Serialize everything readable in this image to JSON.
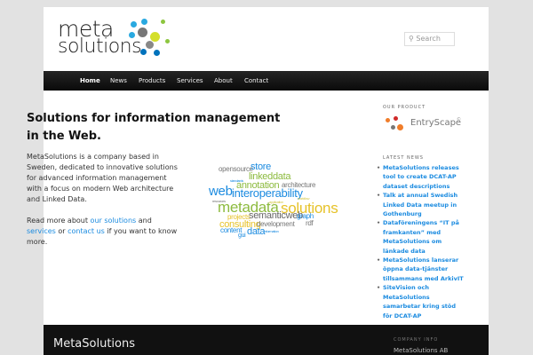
{
  "logo": {
    "line1": "meta",
    "line2": "solutions"
  },
  "search": {
    "placeholder": "Search"
  },
  "nav": {
    "items": [
      "Home",
      "News",
      "Products",
      "Services",
      "About",
      "Contact"
    ]
  },
  "main": {
    "title": "Solutions for information management in the Web.",
    "intro": "MetaSolutions is a company based in Sweden, dedicated to innovative solutions for advanced information management with a focus on modern Web architecture and Linked Data.",
    "read_prefix": "Read more about ",
    "link_solutions": "our solutions",
    "and": " and ",
    "link_services": "services",
    "or": " or ",
    "link_contact": "contact us",
    "read_suffix": " if you want to know more."
  },
  "word_cloud": [
    "opensource",
    "store",
    "linkeddata",
    "standards",
    "annotation",
    "architecture",
    "web",
    "interoperability",
    "resources",
    "application",
    "metadata",
    "solutions",
    "projects",
    "semanticweb",
    "graph",
    "consulting",
    "development",
    "rdf",
    "content",
    "data",
    "information",
    "gui",
    "workflow"
  ],
  "sidebar": {
    "product_heading": "OUR PRODUCT",
    "product_name": "EntryScape",
    "product_mark": "©",
    "news_heading": "LATEST NEWS",
    "news": [
      "MetaSolutions releases tool to create DCAT-AP dataset descriptions",
      "Talk at annual Swedish Linked Data meetup in Gothenburg",
      "Dataföreningens “IT på framkanten” med MetaSolutions om länkade data",
      "MetaSolutions lanserar öppna data-tjänster tillsammans med ArkivIT",
      "SiteVision och MetaSolutions samarbetar kring stöd för DCAT-AP"
    ]
  },
  "footer": {
    "name": "MetaSolutions",
    "info_heading": "COMPANY INFO",
    "company": "MetaSolutions AB"
  }
}
